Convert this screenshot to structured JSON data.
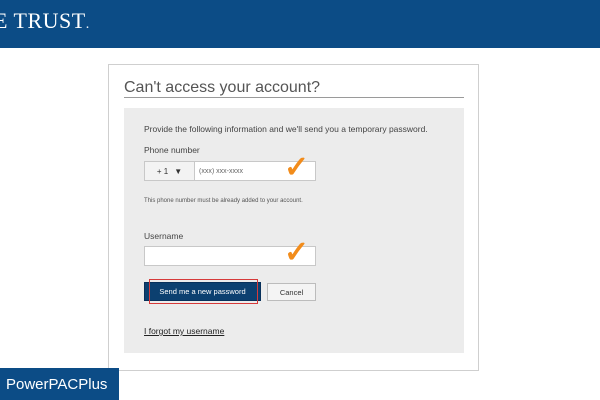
{
  "header": {
    "brand_text": "E TRUST",
    "brand_mark": "."
  },
  "dialog": {
    "title": "Can't access your account?",
    "instructions": "Provide the following information and we'll send you a temporary password.",
    "phone": {
      "label": "Phone number",
      "country_code": "+ 1",
      "caret_icon": "triangle-down",
      "placeholder": "(xxx) xxx-xxxx",
      "help_text": "This phone number must be already added to your account."
    },
    "username": {
      "label": "Username",
      "value": ""
    },
    "buttons": {
      "send": "Send me a new password",
      "cancel": "Cancel"
    },
    "forgot_link": "I forgot my username"
  },
  "annotations": {
    "checkmark_glyph": "✓",
    "checkmark_color": "#f28c1b",
    "highlight_color": "#d63a3a"
  },
  "badge": {
    "label": "PowerPACPlus"
  },
  "colors": {
    "brand_blue": "#0c4c86",
    "button_blue": "#0c4070",
    "form_bg": "#ececec"
  }
}
